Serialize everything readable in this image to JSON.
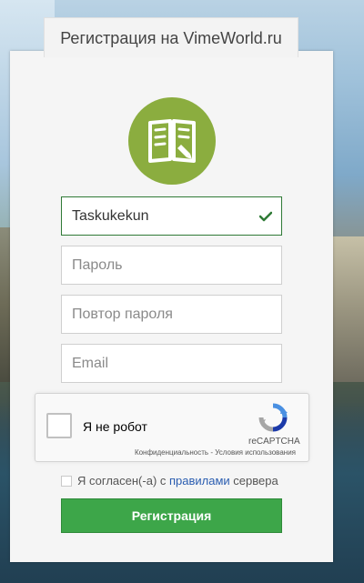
{
  "header": {
    "title": "Регистрация на VimeWorld.ru"
  },
  "logo": {
    "icon": "book-pencil-icon",
    "color": "#8bad3f"
  },
  "form": {
    "username": {
      "value": "Taskukekun",
      "valid": true
    },
    "password": {
      "placeholder": "Пароль"
    },
    "password_repeat": {
      "placeholder": "Повтор пароля"
    },
    "email": {
      "placeholder": "Email"
    }
  },
  "captcha": {
    "label": "Я не робот",
    "brand": "reCAPTCHA",
    "privacy": "Конфиденциальность",
    "separator": " - ",
    "terms": "Условия использования"
  },
  "agreement": {
    "prefix": "Я согласен(-а) с ",
    "link": "правилами",
    "suffix": " сервера"
  },
  "submit": {
    "label": "Регистрация",
    "color": "#3da649"
  }
}
